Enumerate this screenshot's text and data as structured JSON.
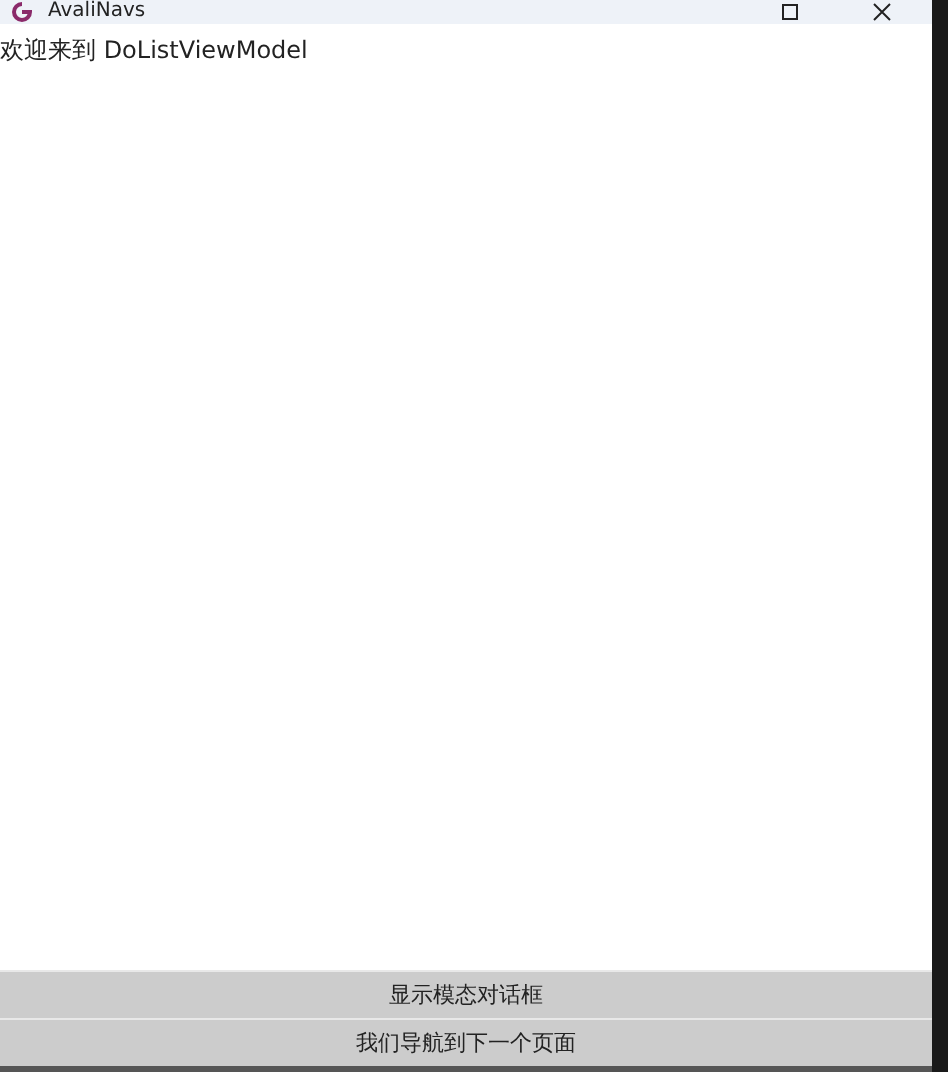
{
  "window": {
    "title": "AvaliNavs"
  },
  "content": {
    "welcome_text": "欢迎来到 DoListViewModel"
  },
  "buttons": [
    {
      "label": "显示模态对话框"
    },
    {
      "label": "我们导航到下一个页面"
    }
  ]
}
